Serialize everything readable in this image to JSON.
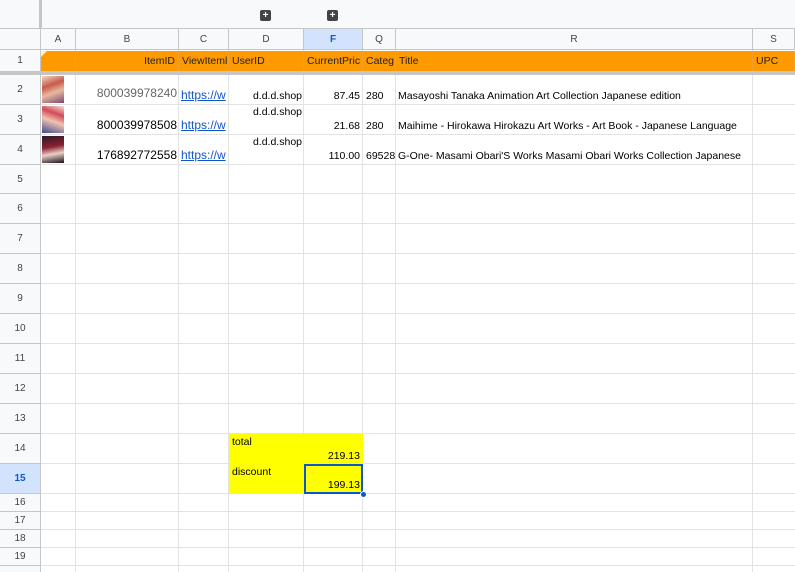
{
  "columns": [
    "A",
    "B",
    "C",
    "D",
    "F",
    "Q",
    "R",
    "S"
  ],
  "group_buttons": [
    "+",
    "+"
  ],
  "rows": [
    "1",
    "2",
    "3",
    "4",
    "5",
    "6",
    "7",
    "8",
    "9",
    "10",
    "11",
    "12",
    "13",
    "14",
    "15",
    "16",
    "17",
    "18",
    "19"
  ],
  "header": {
    "itemid": "ItemID",
    "viewitem": "ViewIteml",
    "userid": "UserID",
    "currentprice": "CurrentPric",
    "category": "Categ",
    "title": "Title",
    "upc": "UPC"
  },
  "data_rows": [
    {
      "itemid": "800039978240",
      "url": "https://w",
      "user": "d.d.d.shop",
      "price": "87.45",
      "cat": "280",
      "title": "Masayoshi Tanaka Animation Art Collection Japanese edition",
      "thumb": "anime-art-thumbnail"
    },
    {
      "itemid": "800039978508",
      "url": "https://w",
      "user": "d.d.d.shop",
      "price": "21.68",
      "cat": "280",
      "title": "Maihime - Hirokawa Hirokazu Art Works - Art Book - Japanese Language",
      "thumb": "anime-art-thumbnail"
    },
    {
      "itemid": "176892772558",
      "url": "https://w",
      "user": "d.d.d.shop",
      "price": "110.00",
      "cat": "69528",
      "title": "G-One- Masami Obari'S Works Masami Obari Works Collection Japanese",
      "thumb": "anime-art-thumbnail"
    }
  ],
  "summary": {
    "total_label": "total",
    "total_value": "219.13",
    "discount_label": "discount",
    "discount_value": "199.13"
  },
  "colors": {
    "header_bg": "#ff9900",
    "highlight": "#ffff00",
    "selection": "#0b57d0"
  }
}
